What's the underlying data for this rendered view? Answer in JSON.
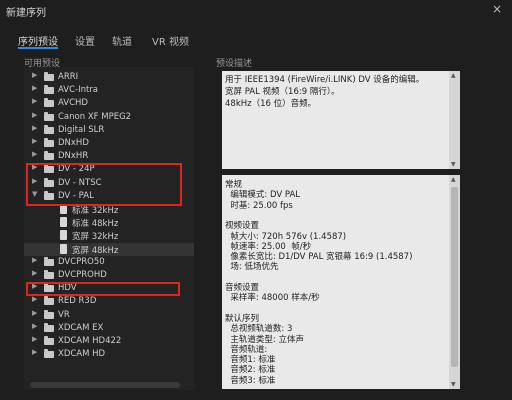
{
  "window": {
    "title": "新建序列",
    "close_glyph": "×"
  },
  "tabs": [
    {
      "label": "序列预设",
      "active": true
    },
    {
      "label": "设置",
      "active": false
    },
    {
      "label": "轨道",
      "active": false
    },
    {
      "label": "VR 视频",
      "active": false
    }
  ],
  "presets_panel": {
    "label": "可用预设",
    "items": [
      {
        "label": "ARRI",
        "type": "folder",
        "expanded": false,
        "highlighted": false
      },
      {
        "label": "AVC-Intra",
        "type": "folder",
        "expanded": false,
        "highlighted": false
      },
      {
        "label": "AVCHD",
        "type": "folder",
        "expanded": false,
        "highlighted": false
      },
      {
        "label": "Canon XF MPEG2",
        "type": "folder",
        "expanded": false,
        "highlighted": false
      },
      {
        "label": "Digital SLR",
        "type": "folder",
        "expanded": false,
        "highlighted": false
      },
      {
        "label": "DNxHD",
        "type": "folder",
        "expanded": false,
        "highlighted": false
      },
      {
        "label": "DNxHR",
        "type": "folder",
        "expanded": false,
        "highlighted": false
      },
      {
        "label": "DV - 24P",
        "type": "folder",
        "expanded": false,
        "highlighted": true
      },
      {
        "label": "DV - NTSC",
        "type": "folder",
        "expanded": false,
        "highlighted": true
      },
      {
        "label": "DV - PAL",
        "type": "folder",
        "expanded": true,
        "highlighted": true
      },
      {
        "label": "标准 32kHz",
        "type": "file",
        "highlighted": false
      },
      {
        "label": "标准 48kHz",
        "type": "file",
        "highlighted": false
      },
      {
        "label": "宽屏 32kHz",
        "type": "file",
        "highlighted": false
      },
      {
        "label": "宽屏 48kHz",
        "type": "file",
        "selected": true,
        "highlighted": false
      },
      {
        "label": "DVCPRO50",
        "type": "folder",
        "expanded": false,
        "highlighted": false
      },
      {
        "label": "DVCPROHD",
        "type": "folder",
        "expanded": false,
        "highlighted": false
      },
      {
        "label": "HDV",
        "type": "folder",
        "expanded": false,
        "highlighted": true
      },
      {
        "label": "RED R3D",
        "type": "folder",
        "expanded": false,
        "highlighted": false
      },
      {
        "label": "VR",
        "type": "folder",
        "expanded": false,
        "highlighted": false
      },
      {
        "label": "XDCAM EX",
        "type": "folder",
        "expanded": false,
        "highlighted": false
      },
      {
        "label": "XDCAM HD422",
        "type": "folder",
        "expanded": false,
        "highlighted": false
      },
      {
        "label": "XDCAM HD",
        "type": "folder",
        "expanded": false,
        "highlighted": false
      }
    ]
  },
  "description_panel": {
    "label": "预设描述",
    "text_lines": [
      "用于 IEEE1394 (FireWire/i.LINK) DV 设备的编辑。",
      "宽屏 PAL 视频（16:9 隔行）。",
      "48kHz（16 位）音频。"
    ]
  },
  "info_panel": {
    "lines": [
      "常规",
      "  编辑模式: DV PAL",
      "  时基: 25.00 fps",
      "",
      "视频设置",
      "  帧大小: 720h 576v (1.4587)",
      "  帧速率: 25.00  帧/秒",
      "  像素长宽比: D1/DV PAL 宽银幕 16:9 (1.4587)",
      "  场: 低场优先",
      "",
      "音频设置",
      "  采样率: 48000 样本/秒",
      "",
      "默认序列",
      "  总视频轨道数: 3",
      "  主轨道类型: 立体声",
      "  音频轨道:",
      "  音频1: 标准",
      "  音频2: 标准",
      "  音频3: 标准"
    ]
  },
  "icons": {
    "collapsed_arrow": "▶",
    "expanded_arrow": "▼",
    "scroll_up": "▲",
    "scroll_down": "▼"
  },
  "colors": {
    "highlight_border": "#e02424",
    "active_tab_underline": "#2d8ceb",
    "panel_bg": "#232323",
    "text_box_bg": "#e9e9e9"
  }
}
